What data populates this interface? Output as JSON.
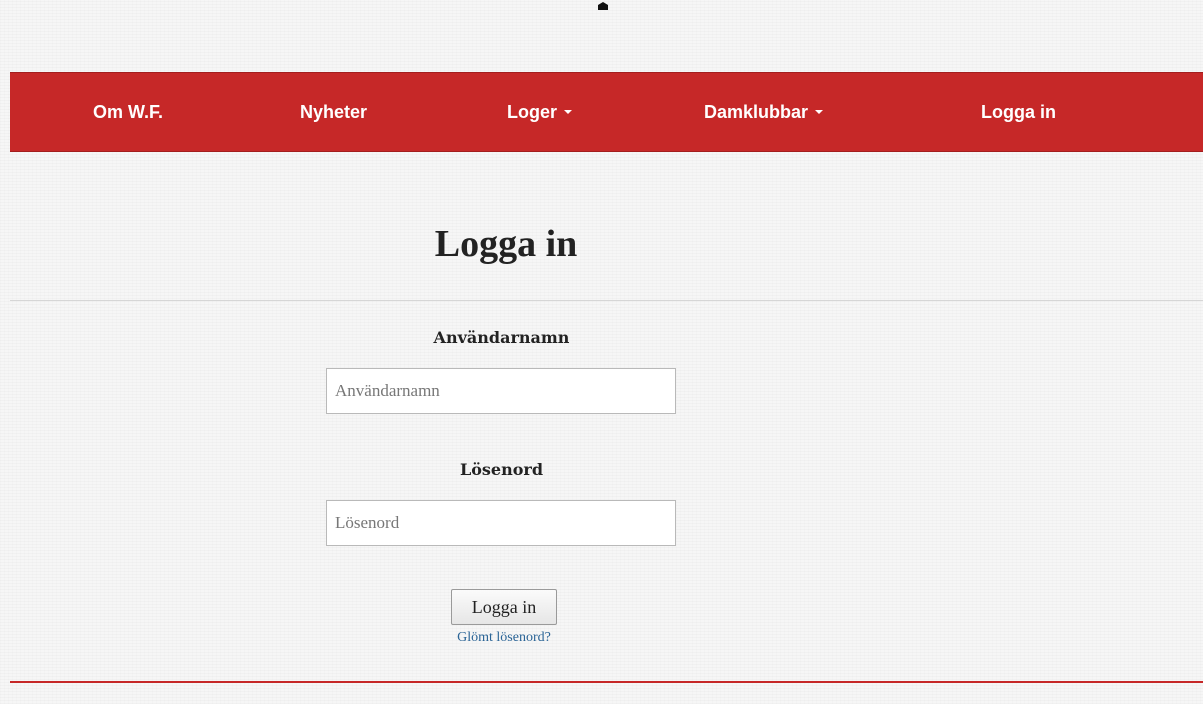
{
  "nav": {
    "items": [
      {
        "label": "Om W.F.",
        "dropdown": false
      },
      {
        "label": "Nyheter",
        "dropdown": false
      },
      {
        "label": "Loger",
        "dropdown": true
      },
      {
        "label": "Damklubbar",
        "dropdown": true
      },
      {
        "label": "Logga in",
        "dropdown": false
      }
    ]
  },
  "login": {
    "title": "Logga in",
    "username": {
      "label": "Användarnamn",
      "placeholder": "Användarnamn",
      "value": ""
    },
    "password": {
      "label": "Lösenord",
      "placeholder": "Lösenord",
      "value": ""
    },
    "submit_label": "Logga in",
    "forgot_link": "Glömt lösenord?"
  },
  "colors": {
    "brand_red": "#c62828",
    "link_blue": "#2a6496",
    "page_background": "#f6f6f6"
  },
  "icons": {
    "dropdown": "caret-down-icon"
  }
}
